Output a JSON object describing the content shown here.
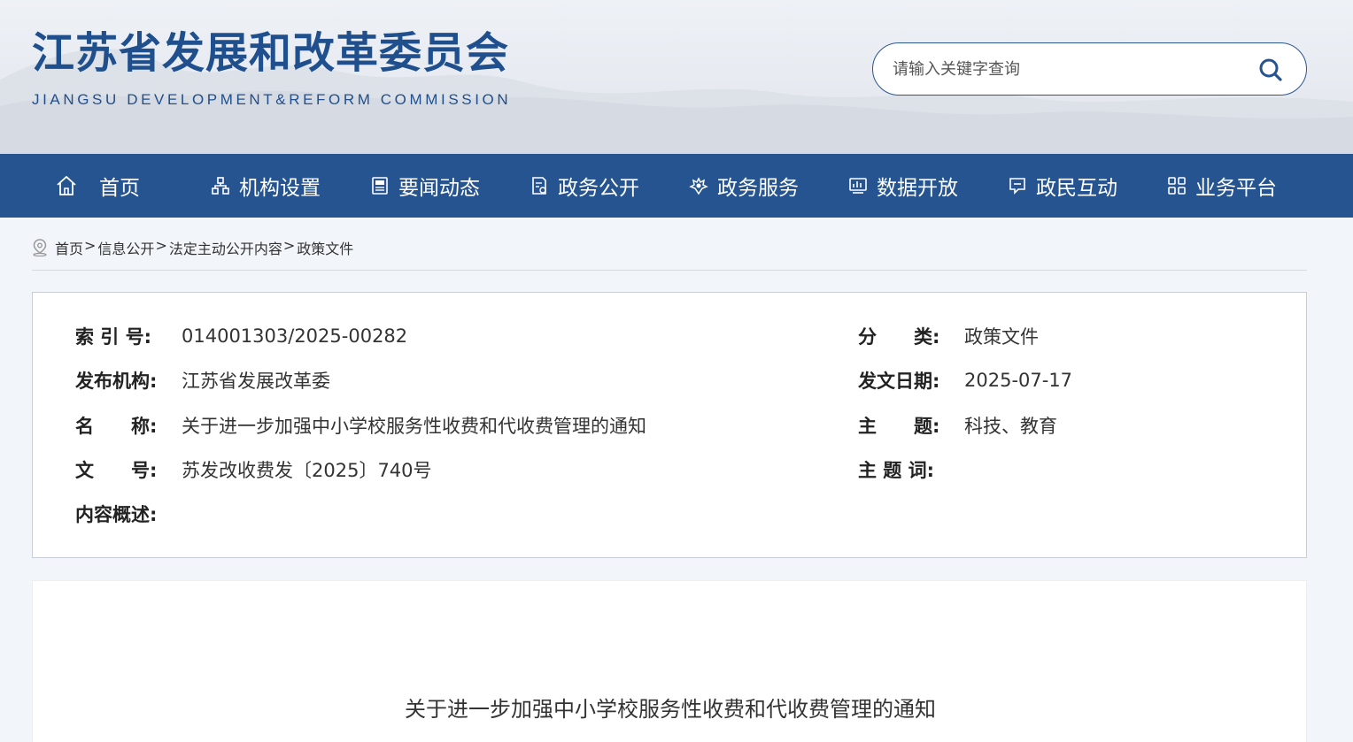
{
  "header": {
    "title": "江苏省发展和改革委员会",
    "subtitle": "JIANGSU DEVELOPMENT&REFORM COMMISSION"
  },
  "search": {
    "placeholder": "请输入关键字查询"
  },
  "nav": {
    "items": [
      {
        "label": "首页",
        "icon": "home-icon"
      },
      {
        "label": "机构设置",
        "icon": "org-chart-icon"
      },
      {
        "label": "要闻动态",
        "icon": "news-icon"
      },
      {
        "label": "政务公开",
        "icon": "document-icon"
      },
      {
        "label": "政务服务",
        "icon": "service-icon"
      },
      {
        "label": "数据开放",
        "icon": "data-icon"
      },
      {
        "label": "政民互动",
        "icon": "chat-icon"
      },
      {
        "label": "业务平台",
        "icon": "grid-icon"
      }
    ]
  },
  "breadcrumb": {
    "items": [
      "首页",
      "信息公开",
      "法定主动公开内容",
      "政策文件"
    ]
  },
  "meta": {
    "index_label": "索 引 号:",
    "index_value": "014001303/2025-00282",
    "category_label": "分　　类:",
    "category_value": "政策文件",
    "publisher_label": "发布机构:",
    "publisher_value": "江苏省发展改革委",
    "date_label": "发文日期:",
    "date_value": "2025-07-17",
    "name_label": "名　　称:",
    "name_value": "关于进一步加强中小学校服务性收费和代收费管理的通知",
    "topic_label": "主　　题:",
    "topic_value": "科技、教育",
    "docno_label": "文　　号:",
    "docno_value": "苏发改收费发〔2025〕740号",
    "keywords_label": "主 题 词:",
    "keywords_value": "",
    "summary_label": "内容概述:",
    "summary_value": ""
  },
  "content": {
    "title": "关于进一步加强中小学校服务性收费和代收费管理的通知"
  },
  "colors": {
    "primary": "#255490",
    "title": "#1f4f8c"
  }
}
